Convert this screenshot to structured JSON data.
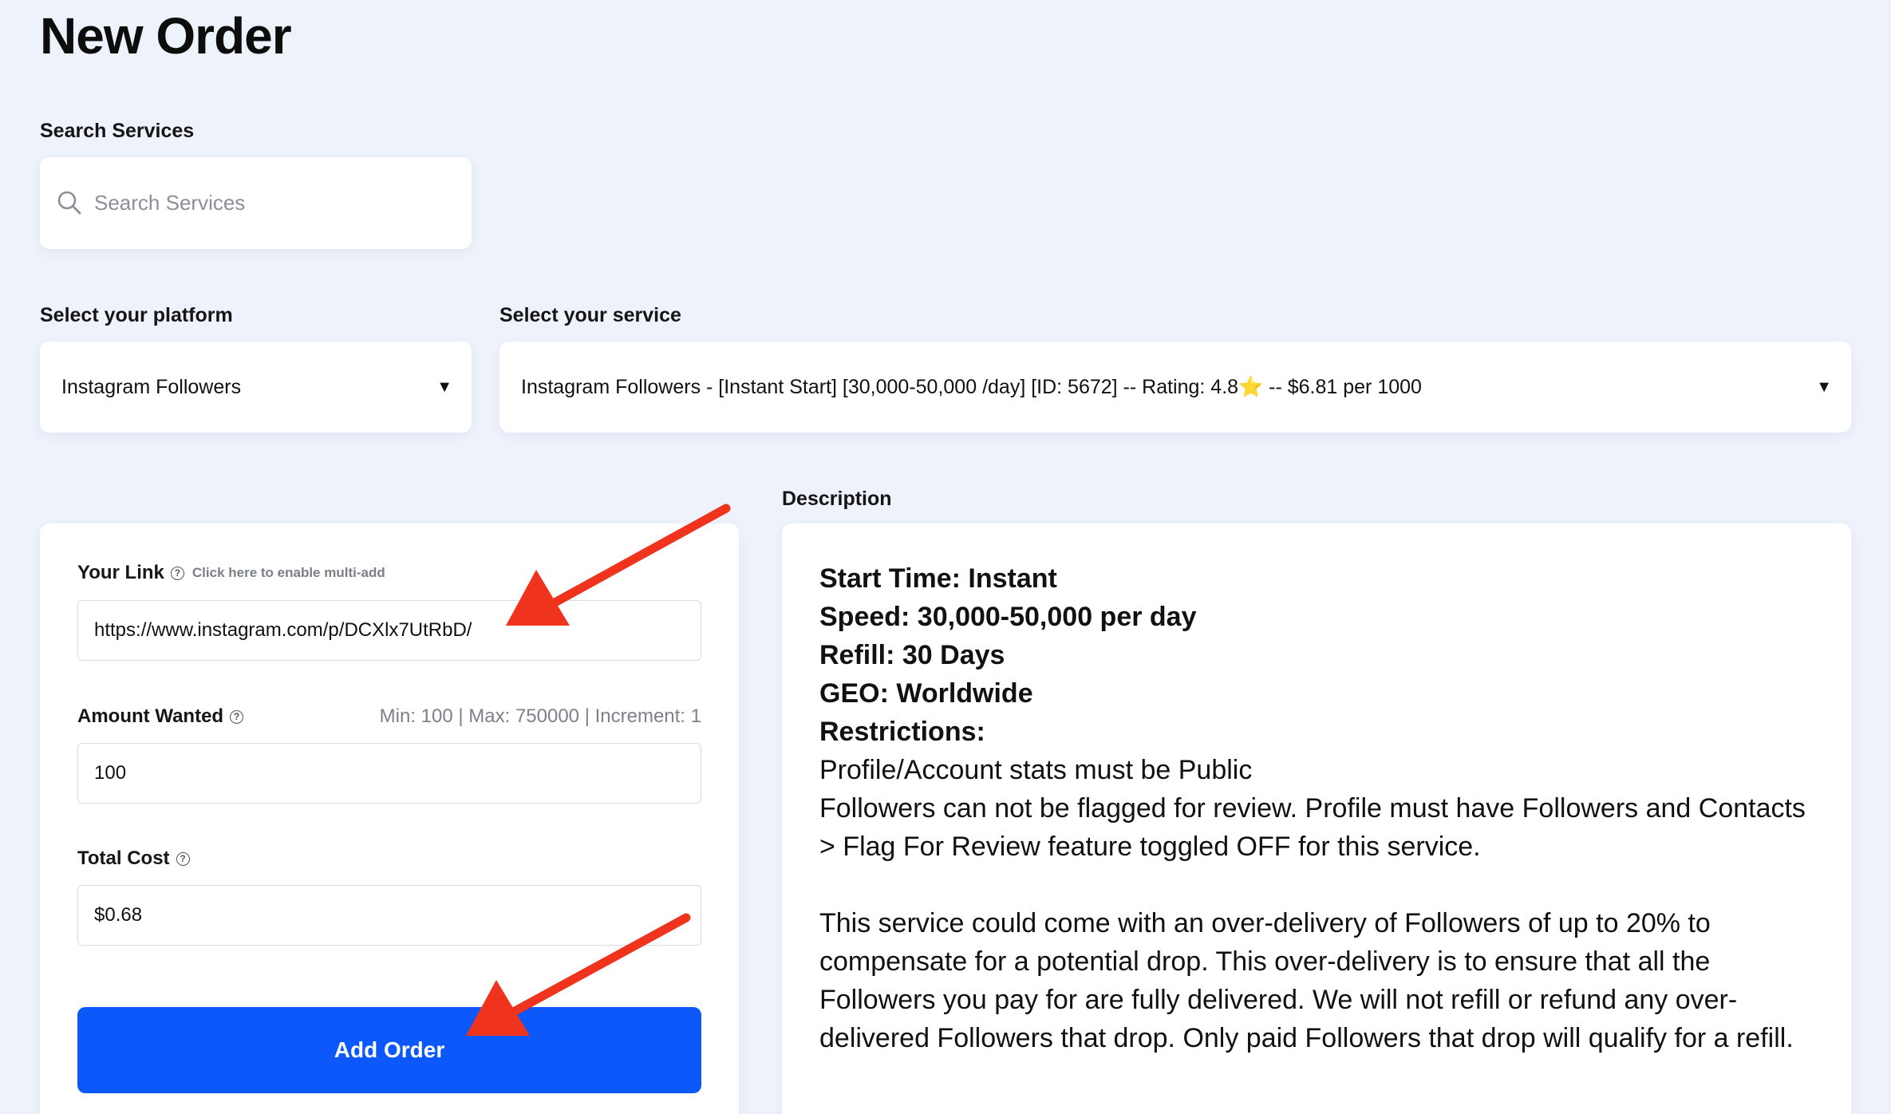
{
  "page": {
    "title": "New Order"
  },
  "search": {
    "label": "Search Services",
    "placeholder": "Search Services",
    "icon": "search-icon"
  },
  "platform": {
    "label": "Select your platform",
    "selected": "Instagram Followers",
    "caret": "▼"
  },
  "service": {
    "label": "Select your service",
    "selected": "Instagram Followers - [Instant Start] [30,000-50,000 /day] [ID: 5672] -- Rating: 4.8⭐ -- $6.81 per 1000",
    "caret": "▼"
  },
  "order_form": {
    "link": {
      "label": "Your Link",
      "help_icon": "?",
      "multi_add": "Click here to enable multi-add",
      "value": "https://www.instagram.com/p/DCXlx7UtRbD/"
    },
    "amount": {
      "label": "Amount Wanted",
      "help_icon": "?",
      "limits": "Min: 100 | Max: 750000 | Increment: 1",
      "value": "100"
    },
    "total": {
      "label": "Total Cost",
      "help_icon": "?",
      "value": "$0.68"
    },
    "submit_label": "Add Order"
  },
  "description": {
    "label": "Description",
    "start_time": "Start Time: Instant",
    "speed": "Speed: 30,000-50,000 per day",
    "refill": "Refill: 30 Days",
    "geo": "GEO: Worldwide",
    "restrictions": "Restrictions:",
    "line_public": "Profile/Account stats must be Public",
    "line_flag_1": "Followers can not be flagged for review. Profile must have Followers and Contacts",
    "line_flag_2": "> Flag For Review feature toggled OFF for this service.",
    "line_over_1": "This service could come with an over-delivery of Followers of up to 20% to",
    "line_over_2": "compensate for a potential drop. This over-delivery is to ensure that all the",
    "line_over_3": "Followers you pay for are fully delivered. We will not refill or refund any over-",
    "line_over_4": "delivered Followers that drop. Only paid Followers that drop will qualify for a refill."
  },
  "colors": {
    "background": "#eef2fb",
    "accent": "#0c58fb",
    "annotation_arrow": "#f0331c"
  }
}
